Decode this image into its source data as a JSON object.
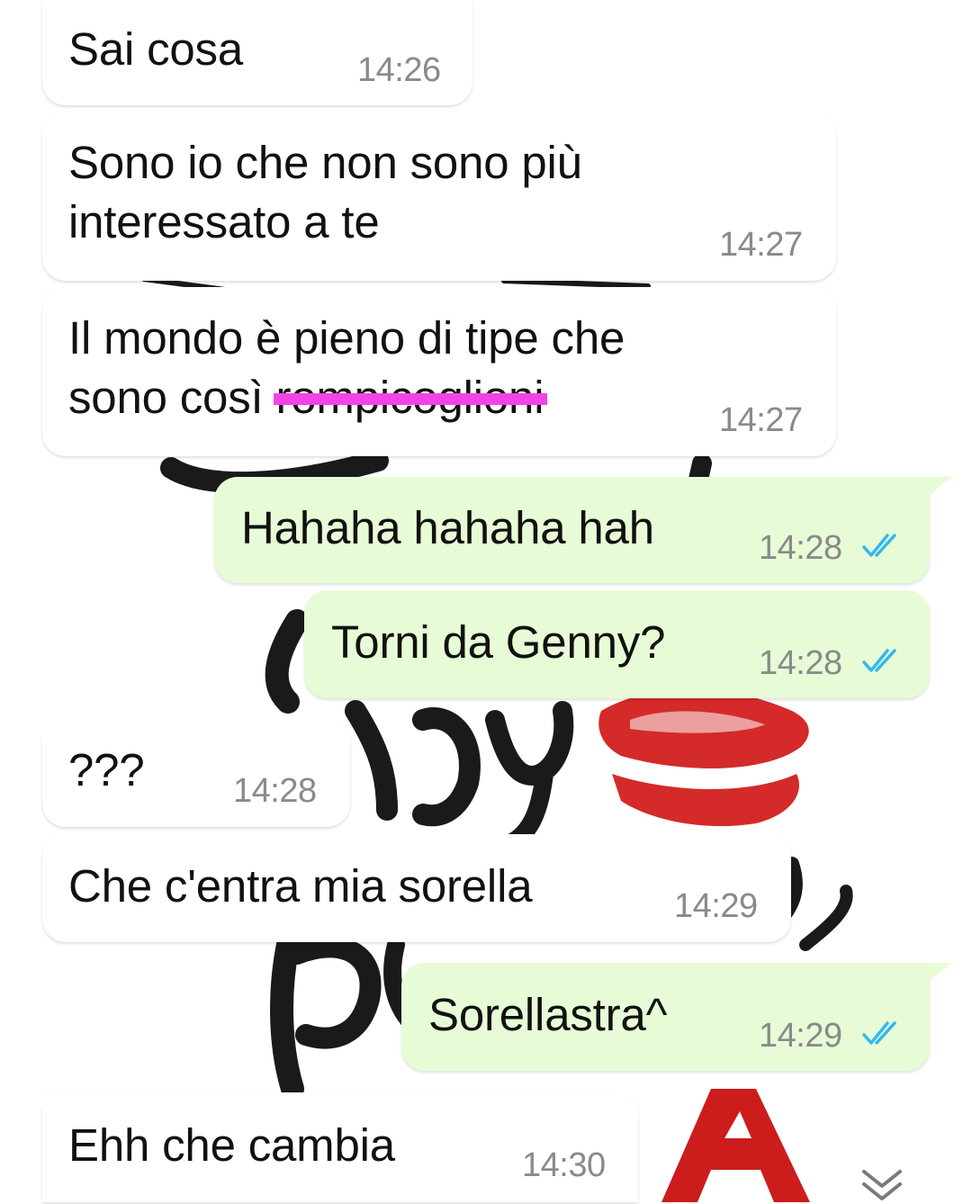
{
  "chat": {
    "messages": [
      {
        "dir": "in",
        "text": "Sai cosa",
        "time": "14:26"
      },
      {
        "dir": "in",
        "text": "Sono io che non sono più\ninteressato a te",
        "time": "14:27"
      },
      {
        "dir": "in",
        "text_before": "Il mondo è pieno di tipe che\nsono così ",
        "text_struck": "rompicoglioni",
        "time": "14:27"
      },
      {
        "dir": "out",
        "text": "Hahaha hahaha hah",
        "time": "14:28",
        "status": "read"
      },
      {
        "dir": "out",
        "text": "Torni da Genny?",
        "time": "14:28",
        "status": "read"
      },
      {
        "dir": "in",
        "text": "???",
        "time": "14:28"
      },
      {
        "dir": "in",
        "text": "Che c'entra mia sorella",
        "time": "14:29"
      },
      {
        "dir": "out",
        "text": "Sorellastra^",
        "time": "14:29",
        "status": "read"
      },
      {
        "dir": "in",
        "text": "Ehh che cambia",
        "time": "14:30"
      }
    ]
  },
  "colors": {
    "incoming_bubble": "#ffffff",
    "outgoing_bubble": "#e7fcd6",
    "read_ticks": "#34b7f1",
    "timestamp": "#8a8a8a",
    "strike_highlight": "#f244e6",
    "wallpaper_lips": "#d42a2a"
  },
  "icons": {
    "read_receipt": "double-check-icon",
    "scroll_down": "double-chevron-down-icon"
  }
}
